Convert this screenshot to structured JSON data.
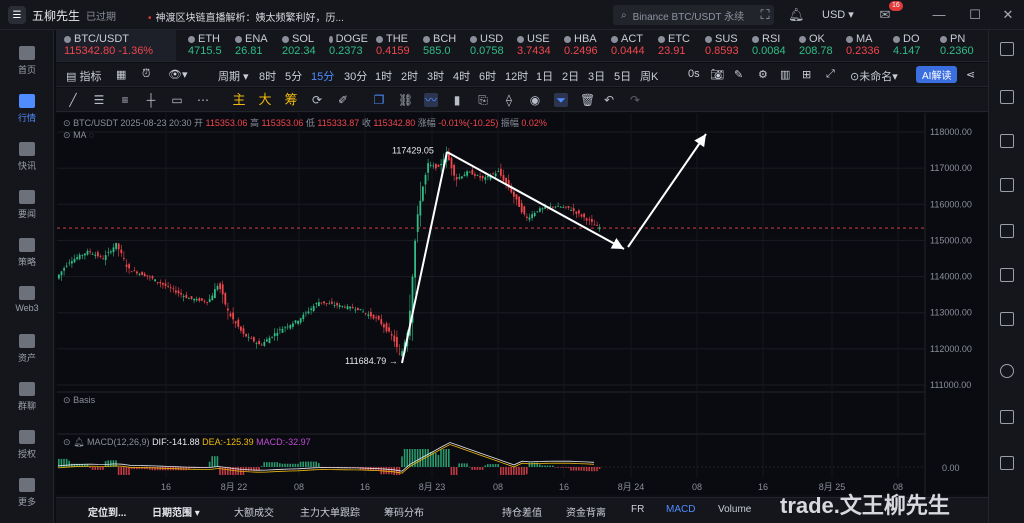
{
  "topbar": {
    "app_name": "五柳先生",
    "expired": "已过期",
    "ticker_text": "神渡区块链直播解析：姨太频繁利好，历...",
    "search_placeholder": "Binance BTC/USDT 永续",
    "currency": "USD",
    "notification_count": "16"
  },
  "left_nav": [
    {
      "label": "首页"
    },
    {
      "label": "行情"
    },
    {
      "label": "快讯"
    },
    {
      "label": "要闻"
    },
    {
      "label": "策略"
    },
    {
      "label": "Web3"
    },
    {
      "label": "资产"
    },
    {
      "label": "群聊"
    },
    {
      "label": "授权"
    },
    {
      "label": "更多"
    }
  ],
  "quotes": [
    {
      "symbol": "BTC/USDT",
      "price": "115342.80",
      "change": "-1.36%",
      "dir": "dn"
    },
    {
      "symbol": "ETH",
      "price": "4715.5",
      "dir": "up"
    },
    {
      "symbol": "ENA",
      "price": "26.81",
      "dir": "up"
    },
    {
      "symbol": "SOL",
      "price": "202.34",
      "dir": "up"
    },
    {
      "symbol": "DOGE",
      "price": "0.2373",
      "dir": "up"
    },
    {
      "symbol": "THE",
      "price": "0.4159",
      "dir": "dn"
    },
    {
      "symbol": "BCH",
      "price": "585.0",
      "dir": "up"
    },
    {
      "symbol": "USD",
      "price": "0.0758",
      "dir": "up"
    },
    {
      "symbol": "USE",
      "price": "3.7434",
      "dir": "dn"
    },
    {
      "symbol": "HBA",
      "price": "0.2496",
      "dir": "dn"
    },
    {
      "symbol": "ACT",
      "price": "0.0444",
      "dir": "dn"
    },
    {
      "symbol": "ETC",
      "price": "23.91",
      "dir": "dn"
    },
    {
      "symbol": "SUS",
      "price": "0.8593",
      "dir": "dn"
    },
    {
      "symbol": "RSI",
      "price": "0.0084",
      "dir": "up"
    },
    {
      "symbol": "OK",
      "price": "208.78",
      "dir": "up"
    },
    {
      "symbol": "MA",
      "price": "0.2336",
      "dir": "dn"
    },
    {
      "symbol": "DO",
      "price": "4.147",
      "dir": "up"
    },
    {
      "symbol": "PN",
      "price": "0.2360",
      "dir": "up"
    }
  ],
  "toolbar": {
    "indicators": "指标",
    "period": "周期",
    "timeframes": [
      "8时",
      "5分",
      "15分",
      "30分",
      "1时",
      "2时",
      "3时",
      "4时",
      "6时",
      "12时",
      "1日",
      "2日",
      "3日",
      "5日",
      "周K"
    ],
    "selected_timeframe": "15分",
    "countdown": "0s",
    "layout_name": "未命名",
    "ai_button": "AI解读"
  },
  "drawing_tools": {
    "main": "主",
    "big": "大",
    "chip": "筹"
  },
  "chart_info": {
    "symbol": "BTC/USDT",
    "datetime": "2025-08-23 20:30",
    "open_label": "开",
    "open": "115353.06",
    "high_label": "高",
    "high": "115353.06",
    "low_label": "低",
    "low": "115333.87",
    "close_label": "收",
    "close": "115342.80",
    "change_label": "涨幅",
    "change": "-0.01%(-10.25)",
    "amplitude_label": "振幅",
    "amplitude": "0.02%",
    "ma_label": "MA",
    "basis_label": "Basis",
    "macd_label": "MACD(12,26,9)",
    "dif": "DIF:-141.88",
    "dea": "DEA:-125.39",
    "macd": "MACD:-32.97"
  },
  "chart_data": {
    "type": "candlestick",
    "y_ticks": [
      "118000.00",
      "117000.00",
      "116000.00",
      "115000.00",
      "114000.00",
      "113000.00",
      "112000.00",
      "111000.00"
    ],
    "macd_tick": "0.00",
    "x_ticks": [
      "16",
      "8月 22",
      "08",
      "16",
      "8月 23",
      "08",
      "16",
      "8月 24",
      "08",
      "16",
      "8月 25",
      "08"
    ],
    "ylim": [
      110700,
      118500
    ],
    "annotations": [
      {
        "text": "117429.05",
        "price": 117429.05
      },
      {
        "text": "111684.79",
        "price": 111684.79
      }
    ],
    "current_price": 115342.8,
    "colors": {
      "up": "#2fbd85",
      "down": "#f0464d",
      "arrow": "#ffffff"
    }
  },
  "bottom_bar": {
    "locate": "定位到...",
    "date_range": "日期范围",
    "tabs": [
      "大额成交",
      "主力大单跟踪",
      "筹码分布",
      "持仓差值",
      "资金背离",
      "FR",
      "MACD",
      "Volume"
    ],
    "selected_tab": "MACD"
  },
  "watermark": "trade.文王柳先生"
}
